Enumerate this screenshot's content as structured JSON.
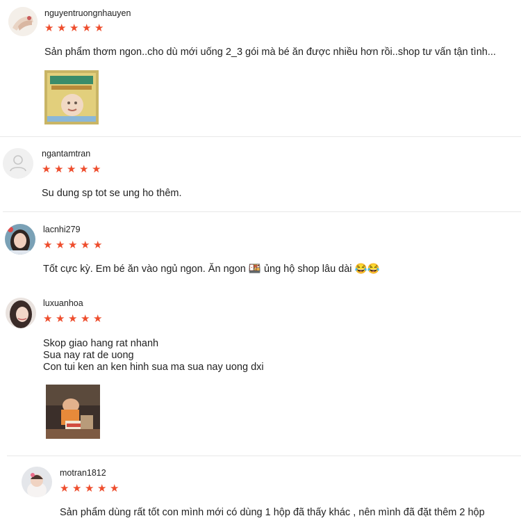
{
  "star_color": "#ee4d2d",
  "reviews": [
    {
      "username": "nguyentruongnhauyen",
      "rating": 5,
      "text": "Sản phẩm thơm ngon..cho dù mới uống 2_3 gói mà bé ăn được nhiều hơn rồi..shop tư vấn tận tình...",
      "has_photo": true
    },
    {
      "username": "ngantamtran",
      "rating": 5,
      "text": "Su dung sp tot se ung ho thêm.",
      "has_photo": false
    },
    {
      "username": "lacnhi279",
      "rating": 5,
      "text": "Tốt cực kỳ. Em bé ăn vào ngủ ngon. Ăn ngon 🍱 ủng hộ shop lâu dài 😂😂",
      "has_photo": false
    },
    {
      "username": "luxuanhoa",
      "rating": 5,
      "text": "Skop giao hang rat nhanh\nSua nay rat de uong\nCon tui ken an ken hinh sua ma sua nay uong dxi",
      "has_photo": true
    },
    {
      "username": "motran1812",
      "rating": 5,
      "text": "Sản phẩm dùng rất tốt con mình mới có dùng 1 hộp đã thấy khác , nên mình đã đặt thêm 2 hộp",
      "has_photo": false
    }
  ]
}
